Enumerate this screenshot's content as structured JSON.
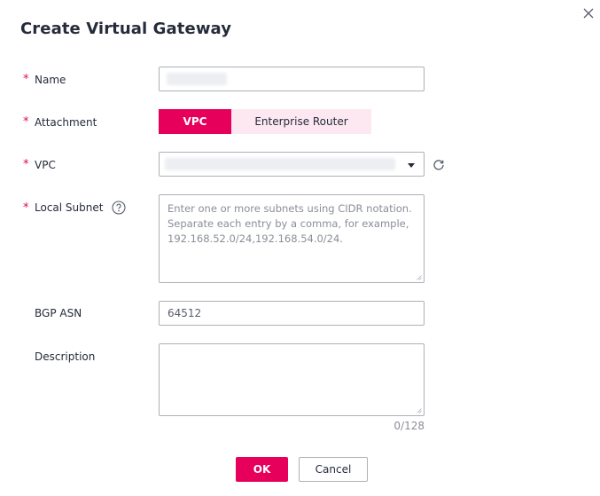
{
  "dialog": {
    "title": "Create Virtual Gateway",
    "close_icon": "close-icon"
  },
  "form": {
    "required_mark": "*",
    "name": {
      "label": "Name",
      "value": ""
    },
    "attachment": {
      "label": "Attachment",
      "options": [
        "VPC",
        "Enterprise Router"
      ],
      "selected": "VPC"
    },
    "vpc": {
      "label": "VPC",
      "value": "",
      "dropdown_icon": "chevron-down-icon",
      "refresh_icon": "refresh-icon"
    },
    "local_subnet": {
      "label": "Local Subnet",
      "help_icon": "help-icon",
      "placeholder": "Enter one or more subnets using CIDR notation. Separate each entry by a comma, for example, 192.168.52.0/24,192.168.54.0/24."
    },
    "bgp_asn": {
      "label": "BGP ASN",
      "value": "64512"
    },
    "description": {
      "label": "Description",
      "value": "",
      "counter": "0/128"
    }
  },
  "buttons": {
    "ok": "OK",
    "cancel": "Cancel"
  },
  "colors": {
    "primary": "#e6005c",
    "secondary_bg": "#fde8f1",
    "border": "#adb0b8"
  }
}
